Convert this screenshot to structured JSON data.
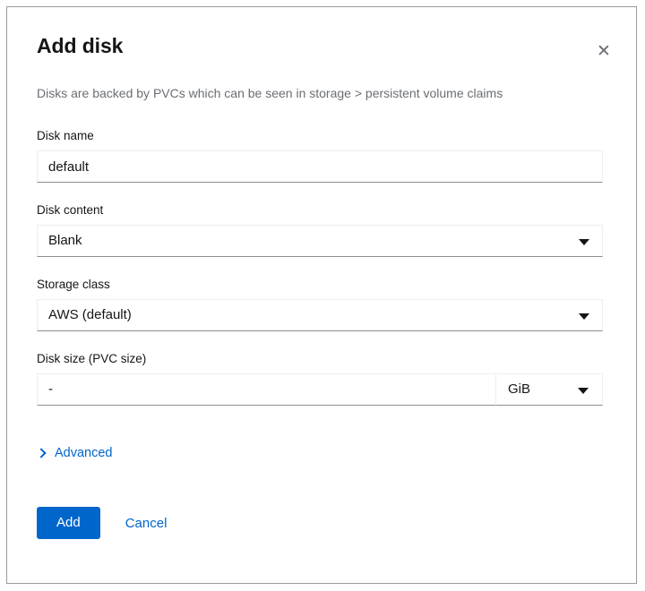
{
  "dialog": {
    "title": "Add disk",
    "subtitle": "Disks are backed by PVCs which can be seen in storage > persistent volume claims",
    "close_icon": "close-icon",
    "close_glyph": "✕"
  },
  "fields": {
    "disk_name": {
      "label": "Disk name",
      "value": "default",
      "placeholder": ""
    },
    "disk_content": {
      "label": "Disk content",
      "value": "Blank",
      "caret_icon": "chevron-down-icon"
    },
    "storage_class": {
      "label": "Storage class",
      "value": "AWS (default)",
      "caret_icon": "chevron-down-icon"
    },
    "disk_size": {
      "label": "Disk size (PVC size)",
      "value": "-",
      "placeholder": "",
      "unit_value": "GiB",
      "caret_icon": "chevron-down-icon"
    }
  },
  "advanced": {
    "label": "Advanced",
    "chevron_icon": "chevron-right-icon"
  },
  "footer": {
    "add_label": "Add",
    "cancel_label": "Cancel"
  },
  "colors": {
    "accent": "#0066cc",
    "text": "#151515",
    "muted_text": "#6a6e73",
    "border": "#ededed",
    "input_underline": "#8a8d90",
    "card_border": "#9a9a9a"
  }
}
